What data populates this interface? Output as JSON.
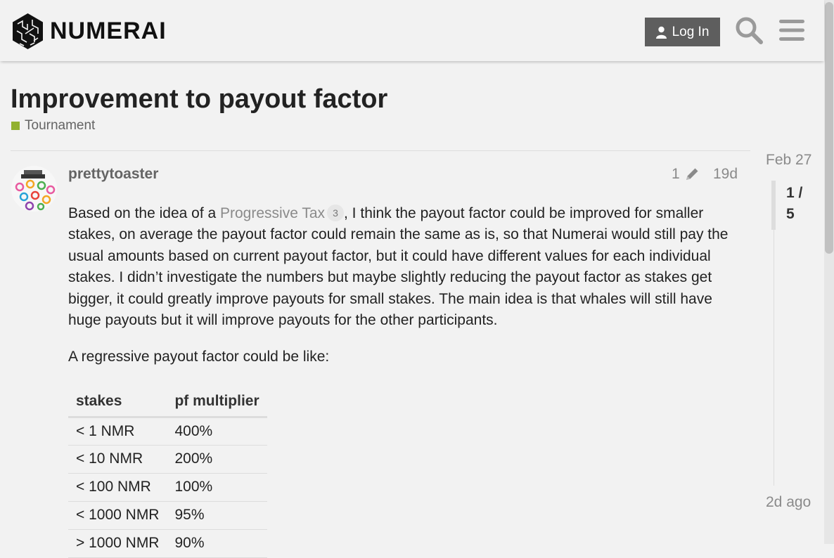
{
  "header": {
    "logo_text": "NUMERAI",
    "login_label": "Log In",
    "search_icon": "search-icon",
    "menu_icon": "hamburger-menu-icon"
  },
  "topic": {
    "title": "Improvement to payout factor",
    "category": "Tournament",
    "category_color": "#92b130"
  },
  "post": {
    "username": "prettytoaster",
    "edit_count": "1",
    "date": "19d",
    "paragraph1_before": "Based on the idea of a ",
    "link_text": "Progressive Tax",
    "link_clicks": "3",
    "paragraph1_after": ", I think the payout factor could be improved for smaller stakes, on average the payout factor could remain the same as is, so that Numerai would still pay the usual amounts based on current payout factor, but it could have different values for each individual stakes. I didn’t investigate the numbers but maybe slightly reducing the payout factor as stakes get bigger, it could greatly improve payouts for small stakes. The main idea is that whales will still have huge payouts but it will improve payouts for the other participants.",
    "paragraph2": "A regressive payout factor could be like:",
    "table": {
      "headers": [
        "stakes",
        "pf multiplier"
      ],
      "rows": [
        [
          "< 1 NMR",
          "400%"
        ],
        [
          "< 10 NMR",
          "200%"
        ],
        [
          "< 100 NMR",
          "100%"
        ],
        [
          "< 1000 NMR",
          "95%"
        ],
        [
          "> 1000 NMR",
          "90%"
        ]
      ]
    }
  },
  "timeline": {
    "start_date": "Feb 27",
    "position": "1 / 5",
    "end_label": "2d ago"
  }
}
